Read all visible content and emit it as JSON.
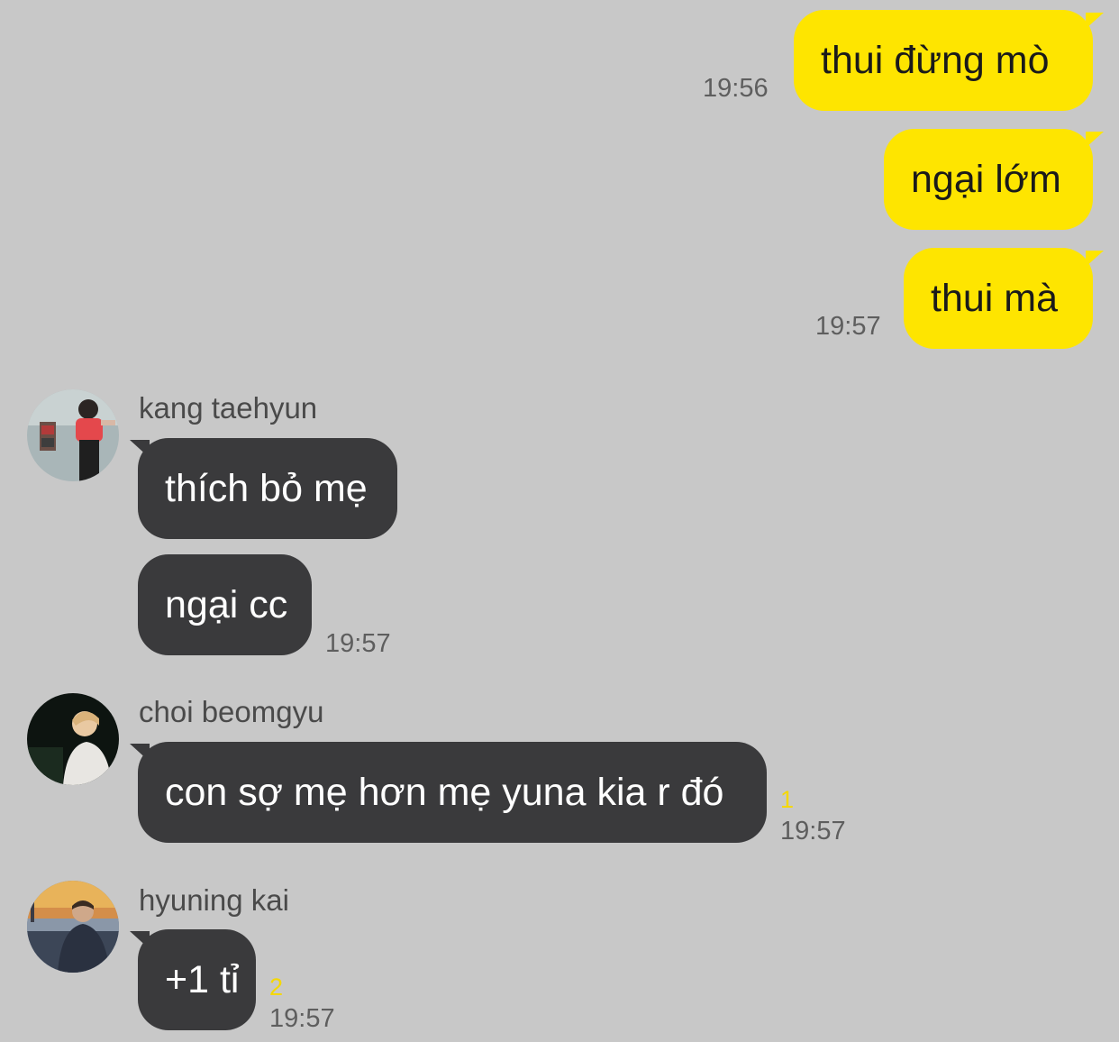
{
  "chat": {
    "messages_out": [
      {
        "text": "thui đừng mò",
        "time": "19:56"
      },
      {
        "text": "ngại lớm",
        "time": ""
      },
      {
        "text": "thui mà",
        "time": "19:57"
      }
    ],
    "groups": [
      {
        "sender": "kang taehyun",
        "avatar_icon": "avatar-photo-red-shirt",
        "messages": [
          {
            "text": "thích bỏ mẹ"
          },
          {
            "text": "ngại cc",
            "time": "19:57"
          }
        ]
      },
      {
        "sender": "choi beomgyu",
        "avatar_icon": "avatar-photo-dark",
        "messages": [
          {
            "text": "con sợ mẹ hơn mẹ yuna kia r đó",
            "unread": "1",
            "time": "19:57"
          }
        ]
      },
      {
        "sender": "hyuning kai",
        "avatar_icon": "avatar-photo-sunset",
        "messages": [
          {
            "text": "+1 tỉ",
            "unread": "2",
            "time": "19:57"
          }
        ]
      }
    ]
  },
  "colors": {
    "background": "#c8c8c8",
    "outgoing_bubble": "#fee500",
    "incoming_bubble": "#3a3a3c",
    "unread_count": "#f5d800"
  }
}
